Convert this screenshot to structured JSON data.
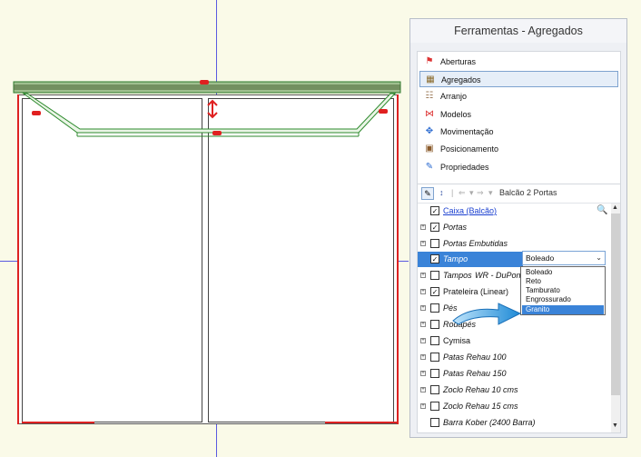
{
  "panel": {
    "title": "Ferramentas - Agregados",
    "sections": [
      {
        "label": "Aberturas",
        "icon": "aberturas-icon"
      },
      {
        "label": "Agregados",
        "icon": "agregados-icon",
        "selected": true
      },
      {
        "label": "Arranjo",
        "icon": "arranjo-icon"
      },
      {
        "label": "Modelos",
        "icon": "modelos-icon"
      },
      {
        "label": "Movimentação",
        "icon": "movimentacao-icon"
      },
      {
        "label": "Posicionamento",
        "icon": "posicionamento-icon"
      },
      {
        "label": "Propriedades",
        "icon": "propriedades-icon"
      }
    ]
  },
  "tree": {
    "breadcrumb": "Balcão 2 Portas",
    "items": [
      {
        "label": "Caixa (Balcão)",
        "checked": true
      },
      {
        "label": "Portas",
        "checked": true
      },
      {
        "label": "Portas Embutidas",
        "checked": false
      },
      {
        "label": "Tampo",
        "checked": true
      },
      {
        "label": "Tampos",
        "label_suffix": "WR - DuPont",
        "checked": false
      },
      {
        "label": "Prateleira (Linear)",
        "checked": true
      },
      {
        "label": "Pés",
        "checked": false
      },
      {
        "label": "Rodapés",
        "checked": false
      },
      {
        "label": "Cymisa",
        "checked": false
      },
      {
        "label": "Patas Rehau 100",
        "checked": false
      },
      {
        "label": "Patas Rehau 150",
        "checked": false
      },
      {
        "label": "Zoclo Rehau 10 cms",
        "checked": false
      },
      {
        "label": "Zoclo Rehau 15 cms",
        "checked": false
      },
      {
        "label": "Barra Kober (2400 Barra)",
        "checked": false
      }
    ]
  },
  "tampo_select": {
    "value": "Boleado",
    "options": [
      "Boleado",
      "Reto",
      "Tamburato",
      "Engrossurado",
      "Granito"
    ],
    "highlighted": "Granito"
  },
  "colors": {
    "accent": "#3a83d8",
    "marker": "#e02020"
  }
}
